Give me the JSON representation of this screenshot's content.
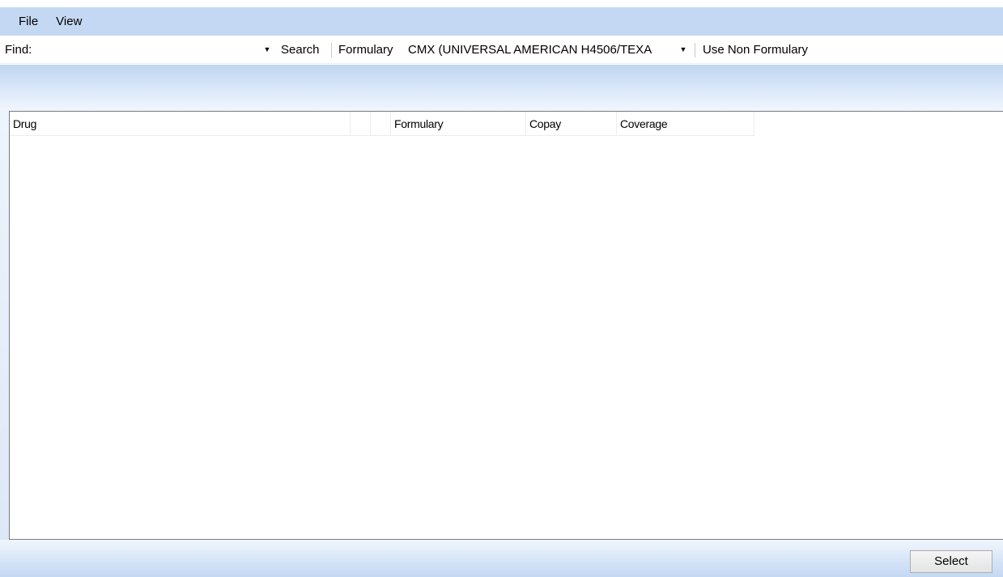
{
  "menu": {
    "items": [
      "File",
      "View"
    ]
  },
  "toolbar": {
    "find_label": "Find:",
    "find_value": "",
    "search_label": "Search",
    "formulary_label": "Formulary",
    "formulary_selected": "CMX (UNIVERSAL AMERICAN H4506/TEXA",
    "use_non_formulary_label": "Use Non Formulary"
  },
  "grid": {
    "columns": [
      "Drug",
      "",
      "",
      "Formulary",
      "Copay",
      "Coverage"
    ],
    "rows": []
  },
  "footer": {
    "select_label": "Select"
  },
  "colors": {
    "menubar": "#c4d8f3",
    "band": "#d6e5f8",
    "border": "#7a7a7a"
  }
}
